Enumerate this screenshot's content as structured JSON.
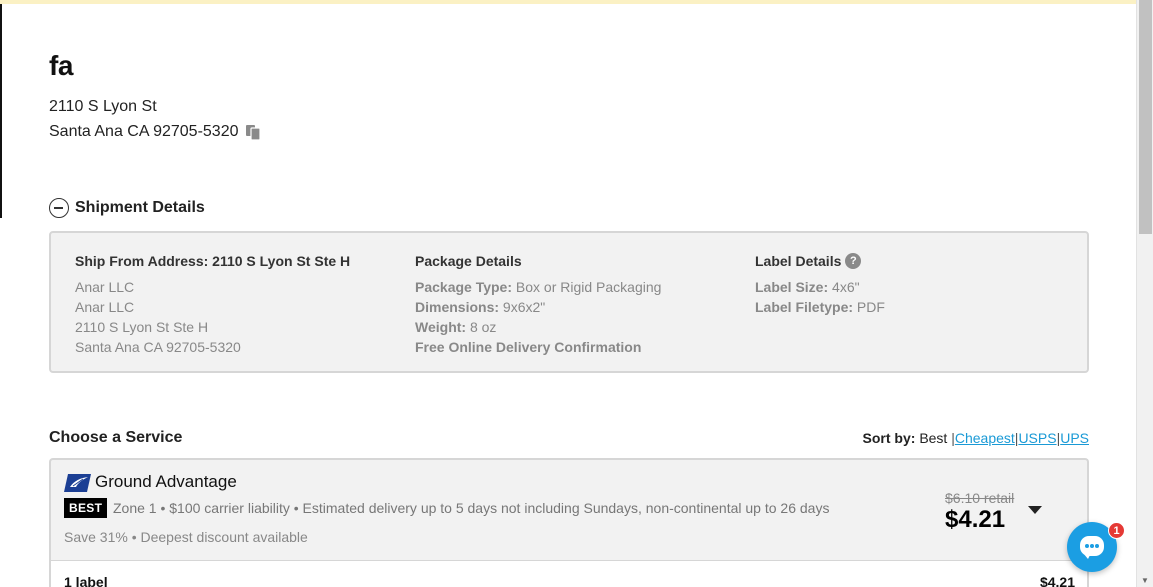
{
  "recipient": {
    "name": "fa",
    "address_line_1": "2110 S Lyon St",
    "address_line_2": "Santa Ana CA 92705-5320"
  },
  "shipment_details": {
    "title": "Shipment Details",
    "ship_from": {
      "heading": "Ship From Address: 2110 S Lyon St Ste H",
      "lines": [
        "Anar LLC",
        "Anar LLC",
        "2110 S Lyon St Ste H",
        "Santa Ana CA 92705-5320"
      ]
    },
    "package": {
      "heading": "Package Details",
      "type_label": "Package Type:",
      "type_value": "Box or Rigid Packaging",
      "dimensions_label": "Dimensions:",
      "dimensions_value": "9x6x2\"",
      "weight_label": "Weight:",
      "weight_value": "8 oz",
      "note": "Free Online Delivery Confirmation"
    },
    "label": {
      "heading": "Label Details",
      "help_icon": "?",
      "size_label": "Label Size:",
      "size_value": "4x6\"",
      "filetype_label": "Label Filetype:",
      "filetype_value": "PDF"
    }
  },
  "choose_service": {
    "title": "Choose a Service",
    "sort": {
      "label": "Sort by:",
      "current": "Best",
      "options": [
        "Cheapest",
        "USPS",
        "UPS"
      ],
      "separator": "|"
    }
  },
  "service": {
    "carrier_icon": "usps-eagle-icon",
    "name": "Ground Advantage",
    "badge": "BEST",
    "description": "Zone 1 • $100 carrier liability • Estimated delivery up to 5 days not including Sundays, non-continental up to 26 days",
    "savings": "Save 31% • Deepest discount available",
    "retail_price": "$6.10 retail",
    "price": "$4.21"
  },
  "summary": {
    "count": "1 label",
    "total": "$4.21"
  },
  "chat": {
    "icon": "chat-icon",
    "badge_count": "1",
    "color": "#1b9ee3"
  },
  "colors": {
    "link": "#1a9ad6",
    "panel_bg": "#f2f2f2",
    "panel_border": "#d6d6d6",
    "top_strip": "#fbf1c4",
    "badge_red": "#e53935"
  }
}
